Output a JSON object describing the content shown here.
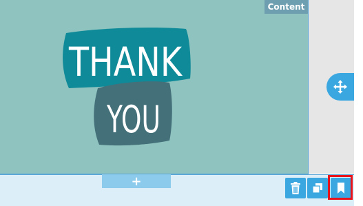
{
  "block": {
    "tab_label": "Content",
    "image_text_top": "THANK",
    "image_text_bottom": "YOU"
  },
  "bottom_bar": {
    "add_label": "+"
  },
  "icons": {
    "move": "move-arrows-icon",
    "delete": "trash-icon",
    "duplicate": "duplicate-icon",
    "save": "bookmark-icon"
  },
  "colors": {
    "block_background": "#8fc3bf",
    "card_top": "#0e8a98",
    "card_bottom": "#44707a",
    "accent": "#3aa7e0",
    "highlight": "#e8141c"
  }
}
